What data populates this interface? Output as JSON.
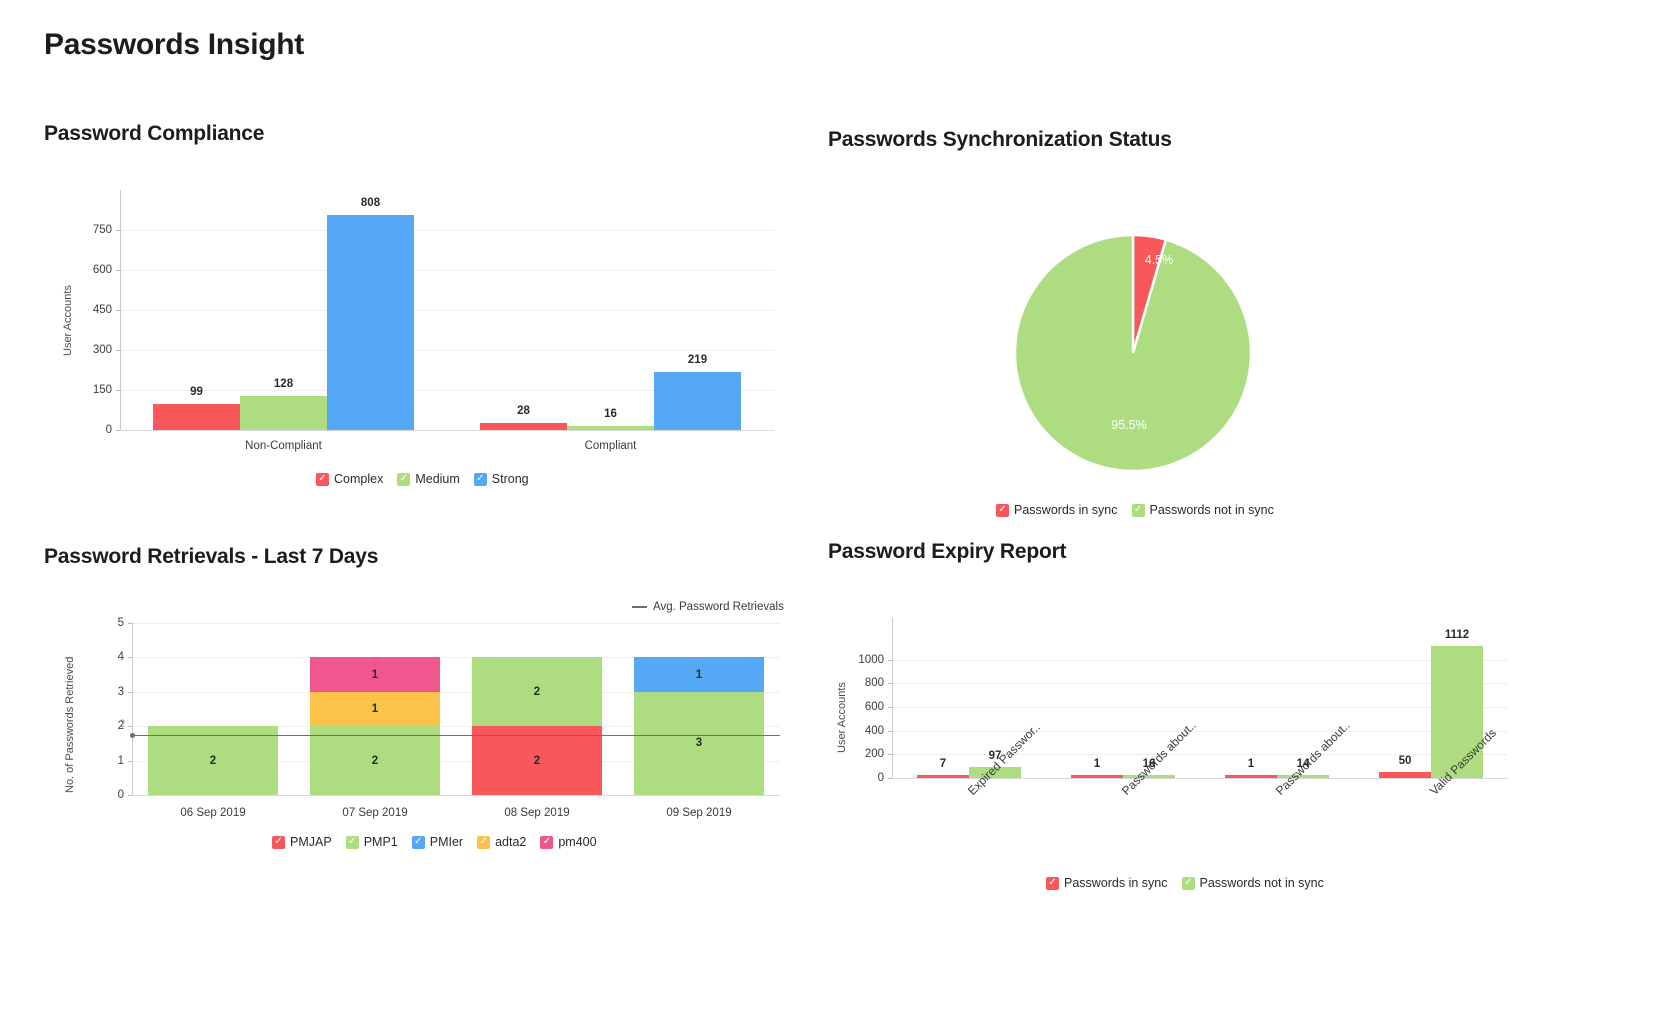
{
  "page": {
    "title": "Passwords Insight"
  },
  "panels": {
    "compliance": {
      "title": "Password Compliance"
    },
    "sync": {
      "title": "Passwords Synchronization Status"
    },
    "retrievals": {
      "title": "Password Retrievals - Last 7 Days"
    },
    "expiry": {
      "title": "Password Expiry Report"
    }
  },
  "colors": {
    "red": "#f8585b",
    "green": "#aedd81",
    "blue": "#55a8f5",
    "orange": "#fbc34a",
    "pink": "#f1578f",
    "grid": "#eeeeee",
    "axis": "#c9c9c9",
    "avg_line": "#6e6e6e"
  },
  "chart_data": [
    {
      "id": "password-compliance",
      "type": "bar",
      "title": "Password Compliance",
      "xlabel": "",
      "ylabel": "User Accounts",
      "categories": [
        "Non-Compliant",
        "Compliant"
      ],
      "ylim": [
        0,
        900
      ],
      "yticks": [
        0,
        150,
        300,
        450,
        600,
        750
      ],
      "grid": true,
      "legend_position": "bottom",
      "series": [
        {
          "name": "Complex",
          "color": "#f8585b",
          "values": [
            99,
            28
          ]
        },
        {
          "name": "Medium",
          "color": "#aedd81",
          "values": [
            128,
            16
          ]
        },
        {
          "name": "Strong",
          "color": "#55a8f5",
          "values": [
            808,
            219
          ]
        }
      ]
    },
    {
      "id": "passwords-synchronization-status",
      "type": "pie",
      "title": "Passwords Synchronization Status",
      "legend_position": "bottom",
      "slices": [
        {
          "name": "Passwords in sync",
          "value": 4.5,
          "label": "4.5%",
          "color": "#f8585b"
        },
        {
          "name": "Passwords not in sync",
          "value": 95.5,
          "label": "95.5%",
          "color": "#aedd81"
        }
      ]
    },
    {
      "id": "password-retrievals-last-7-days",
      "type": "bar",
      "stacked": true,
      "title": "Password Retrievals - Last 7 Days",
      "xlabel": "",
      "ylabel": "No. of Passwords Retrieved",
      "categories": [
        "06 Sep 2019",
        "07 Sep 2019",
        "08 Sep 2019",
        "09 Sep 2019"
      ],
      "ylim": [
        0,
        5
      ],
      "yticks": [
        0,
        1,
        2,
        3,
        4,
        5
      ],
      "grid": true,
      "legend_position": "bottom",
      "series": [
        {
          "name": "PMJAP",
          "color": "#f8585b",
          "values": [
            0,
            0,
            2,
            0
          ]
        },
        {
          "name": "PMP1",
          "color": "#aedd81",
          "values": [
            2,
            2,
            2,
            3
          ]
        },
        {
          "name": "PMIer",
          "color": "#55a8f5",
          "values": [
            0,
            0,
            0,
            1
          ]
        },
        {
          "name": "adta2",
          "color": "#fbc34a",
          "values": [
            0,
            1,
            0,
            0
          ]
        },
        {
          "name": "pm400",
          "color": "#f1578f",
          "values": [
            0,
            1,
            0,
            0
          ]
        }
      ],
      "reference_line": {
        "label": "Avg. Password Retrievals",
        "value": 1.75,
        "axis_label": "2",
        "color": "#6e6e6e"
      }
    },
    {
      "id": "password-expiry-report",
      "type": "bar",
      "title": "Password Expiry Report",
      "xlabel": "",
      "ylabel": "User Accounts",
      "categories": [
        "Expired Passwor..",
        "Passwords about..",
        "Passwords about..",
        "Valid Passwords"
      ],
      "ylim": [
        0,
        1200
      ],
      "yticks": [
        0,
        200,
        400,
        600,
        800,
        1000
      ],
      "grid": true,
      "legend_position": "bottom",
      "series": [
        {
          "name": "Passwords in sync",
          "color": "#f8585b",
          "values": [
            7,
            1,
            1,
            50
          ]
        },
        {
          "name": "Passwords not in sync",
          "color": "#aedd81",
          "values": [
            97,
            16,
            14,
            1112
          ]
        }
      ]
    }
  ]
}
